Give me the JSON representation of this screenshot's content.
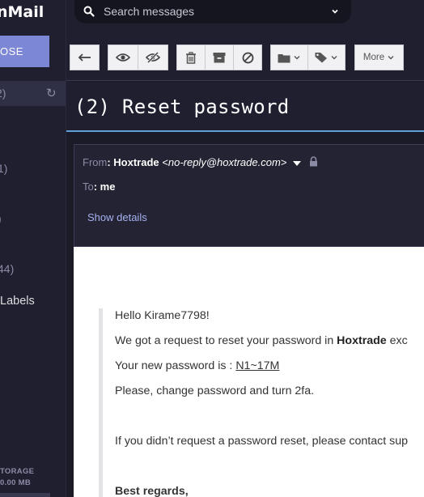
{
  "app": {
    "logo": "nMail"
  },
  "sidebar": {
    "compose_label": "OSE",
    "inbox_count": "2)",
    "counts": [
      "1)",
      ")",
      "44)"
    ],
    "labels_label": "Labels",
    "storage_label": "TORAGE",
    "storage_value": "0.00 MB"
  },
  "search": {
    "placeholder": "Search messages"
  },
  "toolbar": {
    "more_label": "More"
  },
  "message": {
    "subject": "(2) Reset password",
    "from_label": "From",
    "from_name": ": Hoxtrade",
    "from_address": "<no-reply@hoxtrade.com>",
    "to_label": "To",
    "to_value": ": me",
    "show_details": "Show details",
    "body": {
      "greeting": "Hello Kirame7798!",
      "line1_prefix": "We got a request to reset your password in ",
      "line1_bold": "Hoxtrade",
      "line1_suffix": " exc",
      "line2_prefix": "Your new password is : ",
      "password": "N1~17M",
      "line3": "Please, change password and turn 2fa.",
      "line4": "If you didn’t request a password reset, please contact sup",
      "signoff": "Best regards,"
    }
  },
  "colors": {
    "accent": "#7c87d6",
    "sidebar_bg": "#1f1f30",
    "link": "#a6b1ee",
    "selection": "#5fa0d6"
  }
}
